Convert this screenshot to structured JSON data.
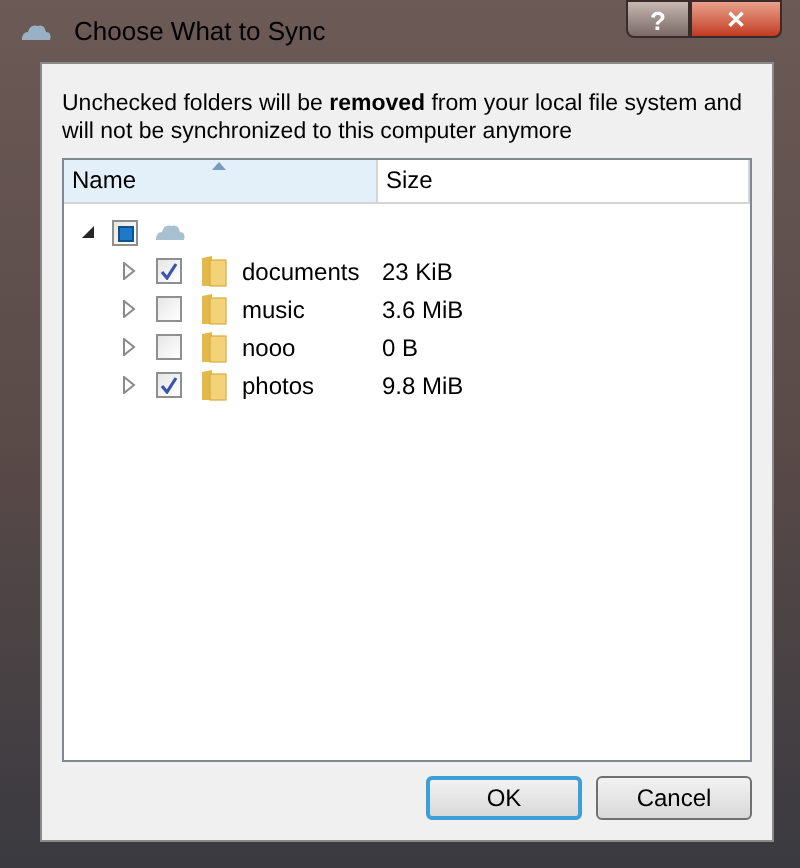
{
  "window": {
    "title": "Choose What to Sync",
    "help_button": "?",
    "close_button": "✕"
  },
  "message": "Unchecked folders will be **removed** from your local file system and will not be synchronized to this computer anymore",
  "tree": {
    "columns": [
      {
        "label": "Name",
        "sorted": true
      },
      {
        "label": "Size",
        "sorted": false
      }
    ],
    "root": {
      "partial": true,
      "expanded": true,
      "children": [
        {
          "name": "documents",
          "size": "23 KiB",
          "checked": true,
          "expanded": false
        },
        {
          "name": "music",
          "size": "3.6 MiB",
          "checked": false,
          "expanded": false
        },
        {
          "name": "nooo",
          "size": "0 B",
          "checked": false,
          "expanded": false
        },
        {
          "name": "photos",
          "size": "9.8 MiB",
          "checked": true,
          "expanded": false
        }
      ]
    }
  },
  "buttons": [
    {
      "label": "OK",
      "default": true
    },
    {
      "label": "Cancel",
      "default": false
    }
  ]
}
